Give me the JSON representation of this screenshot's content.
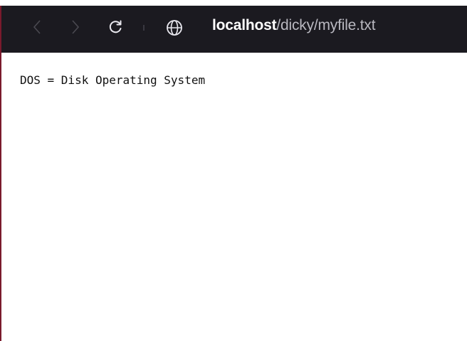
{
  "toolbar": {
    "url_host": "localhost",
    "url_path": "/dicky/myfile.txt"
  },
  "icons": {
    "back": "chevron-left-icon",
    "forward": "chevron-right-icon",
    "reload": "reload-icon",
    "site": "globe-icon"
  },
  "colors": {
    "toolbar_bg": "#1b1a20",
    "url_host": "#ffffff",
    "url_path": "#b9b8c0",
    "edge_accent": "#7a1a2c"
  },
  "page": {
    "content": "DOS = Disk Operating System"
  }
}
